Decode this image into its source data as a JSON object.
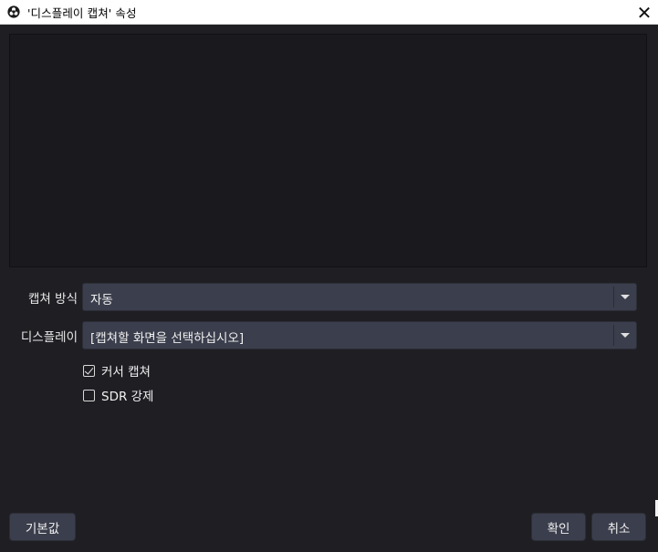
{
  "window": {
    "title": "'디스플레이 캡쳐' 속성",
    "close_glyph": "✕",
    "app_icon": "obs-logo-icon"
  },
  "form": {
    "capture_method": {
      "label": "캡쳐 방식",
      "value": "자동"
    },
    "display": {
      "label": "디스플레이",
      "value": "[캡쳐할 화면을 선택하십시오]"
    },
    "capture_cursor": {
      "label": "커서 캡쳐",
      "checked": true
    },
    "force_sdr": {
      "label": "SDR 강제",
      "checked": false
    }
  },
  "buttons": {
    "defaults": "기본값",
    "ok": "확인",
    "cancel": "취소"
  },
  "colors": {
    "background": "#1f1e23",
    "preview": "#1a191d",
    "control": "#3b3e4c",
    "titlebar": "#ffffff"
  }
}
